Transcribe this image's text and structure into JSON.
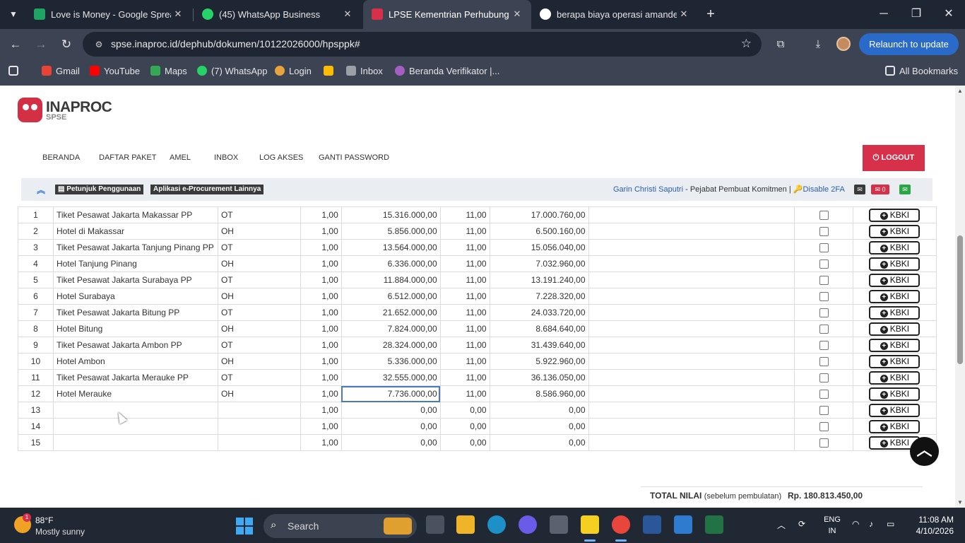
{
  "browser": {
    "tabs": [
      {
        "title": "Love is Money - Google Spreadsheets",
        "color": "#1fa463",
        "icon": "sheets-icon"
      },
      {
        "title": "(45) WhatsApp Business",
        "color": "#25d366",
        "icon": "whatsapp-icon"
      },
      {
        "title": "LPSE Kementrian Perhubungan",
        "color": "#d6304b",
        "icon": "lpse-icon"
      },
      {
        "title": "berapa biaya operasi amandel - Google Search",
        "color": "#ffffff",
        "icon": "google-icon"
      }
    ],
    "url": "spse.inaproc.id/dephub/dokumen/10122026000/hpsppk#",
    "relaunch_label": "Relaunch to update",
    "bookmarks": [
      {
        "label": "Gmail",
        "color": "#ea4335"
      },
      {
        "label": "YouTube",
        "color": "#ff0000"
      },
      {
        "label": "Maps",
        "color": "#34a853"
      },
      {
        "label": "(7) WhatsApp",
        "color": "#25d366"
      },
      {
        "label": "Login",
        "color": "#e8a33d"
      },
      {
        "label": "",
        "color": "#fbbc05"
      },
      {
        "label": "Inbox",
        "color": "#9aa0a6"
      },
      {
        "label": "Beranda Verifikator |...",
        "color": "#a55fc1"
      }
    ],
    "all_bookmarks_label": "All Bookmarks"
  },
  "site": {
    "logo_main": "INA",
    "logo_accent": "PROC",
    "logo_sub": "SPSE",
    "menu": [
      "BERANDA",
      "DAFTAR PAKET",
      "AMEL",
      "INBOX",
      "LOG AKSES",
      "GANTI PASSWORD"
    ],
    "logout_label": "LOGOUT",
    "info_buttons": [
      "Petunjuk Penggunaan",
      "Aplikasi e-Procurement Lainnya"
    ],
    "user_name": "Garin Christi Saputri",
    "user_role": " - Pejabat Pembuat Komitmen | ",
    "disable_2fa": "Disable 2FA",
    "mail_count": "0"
  },
  "table": {
    "button_label": "KBKI",
    "rows": [
      {
        "no": "1",
        "name": "Tiket Pesawat Jakarta Makassar PP",
        "unit": "OT",
        "vol": "1,00",
        "price": "15.316.000,00",
        "tax": "11,00",
        "total": "17.000.760,00"
      },
      {
        "no": "2",
        "name": "Hotel di Makassar",
        "unit": "OH",
        "vol": "1,00",
        "price": "5.856.000,00",
        "tax": "11,00",
        "total": "6.500.160,00"
      },
      {
        "no": "3",
        "name": "Tiket Pesawat Jakarta Tanjung Pinang PP",
        "unit": "OT",
        "vol": "1,00",
        "price": "13.564.000,00",
        "tax": "11,00",
        "total": "15.056.040,00"
      },
      {
        "no": "4",
        "name": "Hotel Tanjung Pinang",
        "unit": "OH",
        "vol": "1,00",
        "price": "6.336.000,00",
        "tax": "11,00",
        "total": "7.032.960,00"
      },
      {
        "no": "5",
        "name": "Tiket Pesawat Jakarta Surabaya PP",
        "unit": "OT",
        "vol": "1,00",
        "price": "11.884.000,00",
        "tax": "11,00",
        "total": "13.191.240,00"
      },
      {
        "no": "6",
        "name": "Hotel Surabaya",
        "unit": "OH",
        "vol": "1,00",
        "price": "6.512.000,00",
        "tax": "11,00",
        "total": "7.228.320,00"
      },
      {
        "no": "7",
        "name": "Tiket Pesawat Jakarta Bitung PP",
        "unit": "OT",
        "vol": "1,00",
        "price": "21.652.000,00",
        "tax": "11,00",
        "total": "24.033.720,00"
      },
      {
        "no": "8",
        "name": "Hotel Bitung",
        "unit": "OH",
        "vol": "1,00",
        "price": "7.824.000,00",
        "tax": "11,00",
        "total": "8.684.640,00"
      },
      {
        "no": "9",
        "name": "Tiket Pesawat Jakarta Ambon PP",
        "unit": "OT",
        "vol": "1,00",
        "price": "28.324.000,00",
        "tax": "11,00",
        "total": "31.439.640,00"
      },
      {
        "no": "10",
        "name": "Hotel Ambon",
        "unit": "OH",
        "vol": "1,00",
        "price": "5.336.000,00",
        "tax": "11,00",
        "total": "5.922.960,00"
      },
      {
        "no": "11",
        "name": "Tiket Pesawat Jakarta Merauke PP",
        "unit": "OT",
        "vol": "1,00",
        "price": "32.555.000,00",
        "tax": "11,00",
        "total": "36.136.050,00"
      },
      {
        "no": "12",
        "name": "Hotel Merauke",
        "unit": "OH",
        "vol": "1,00",
        "price": "7.736.000,00",
        "tax": "11,00",
        "total": "8.586.960,00"
      },
      {
        "no": "13",
        "name": "",
        "unit": "",
        "vol": "1,00",
        "price": "0,00",
        "tax": "0,00",
        "total": "0,00"
      },
      {
        "no": "14",
        "name": "",
        "unit": "",
        "vol": "1,00",
        "price": "0,00",
        "tax": "0,00",
        "total": "0,00"
      },
      {
        "no": "15",
        "name": "",
        "unit": "",
        "vol": "1,00",
        "price": "0,00",
        "tax": "0,00",
        "total": "0,00"
      }
    ],
    "total_label": "TOTAL NILAI",
    "total_note": "(sebelum pembulatan)",
    "total_value": "Rp. 180.813.450,00"
  },
  "taskbar": {
    "weather_temp": "88°F",
    "weather_desc": "Mostly sunny",
    "weather_badge": "1",
    "search_placeholder": "Search",
    "lang_line1": "ENG",
    "lang_line2": "IN",
    "time": "11:08 AM",
    "date": "4/10/2026"
  }
}
